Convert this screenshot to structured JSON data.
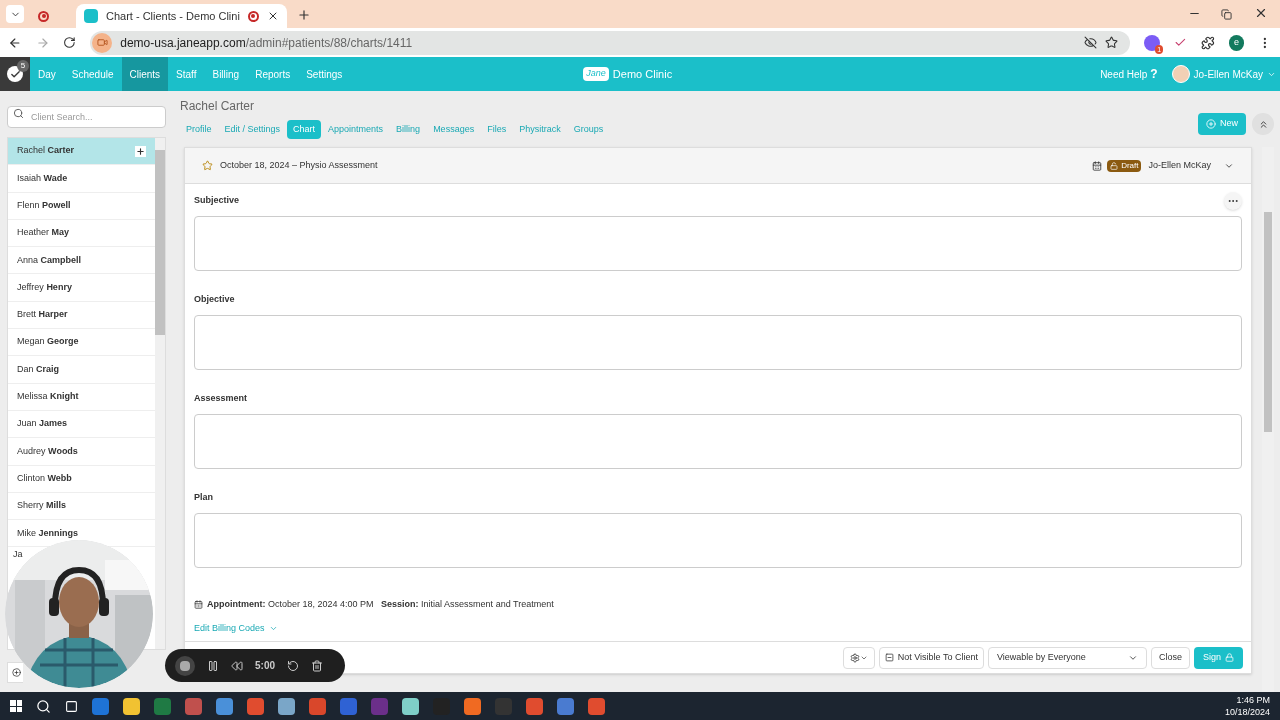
{
  "browser": {
    "tabs": [
      {
        "selected": false
      },
      {
        "title": "Chart - Clients - Demo Clini",
        "selected": true
      }
    ],
    "url_host": "demo-usa.janeapp.com",
    "url_path": "/admin#patients/88/charts/1411",
    "profile_initial": "e",
    "extension_badge": "1"
  },
  "nav": {
    "badge": "5",
    "items": [
      {
        "label": "Day",
        "selected": false
      },
      {
        "label": "Schedule",
        "selected": false
      },
      {
        "label": "Clients",
        "selected": true
      },
      {
        "label": "Staff",
        "selected": false
      },
      {
        "label": "Billing",
        "selected": false
      },
      {
        "label": "Reports",
        "selected": false
      },
      {
        "label": "Settings",
        "selected": false
      }
    ],
    "logo": "Jane",
    "clinic": "Demo Clinic",
    "help": "Need Help",
    "help_mark": "?",
    "user": "Jo-Ellen McKay"
  },
  "sidebar": {
    "search": {
      "placeholder": "Client Search..."
    },
    "clients": [
      {
        "first": "Rachel",
        "last": "Carter",
        "selected": true
      },
      {
        "first": "Isaiah",
        "last": "Wade",
        "selected": false
      },
      {
        "first": "Flenn",
        "last": "Powell",
        "selected": false
      },
      {
        "first": "Heather",
        "last": "May",
        "selected": false
      },
      {
        "first": "Anna",
        "last": "Campbell",
        "selected": false
      },
      {
        "first": "Jeffrey",
        "last": "Henry",
        "selected": false
      },
      {
        "first": "Brett",
        "last": "Harper",
        "selected": false
      },
      {
        "first": "Megan",
        "last": "George",
        "selected": false
      },
      {
        "first": "Dan",
        "last": "Craig",
        "selected": false
      },
      {
        "first": "Melissa",
        "last": "Knight",
        "selected": false
      },
      {
        "first": "Juan",
        "last": "James",
        "selected": false
      },
      {
        "first": "Audrey",
        "last": "Woods",
        "selected": false
      },
      {
        "first": "Clinton",
        "last": "Webb",
        "selected": false
      },
      {
        "first": "Sherry",
        "last": "Mills",
        "selected": false
      },
      {
        "first": "Mike",
        "last": "Jennings",
        "selected": false
      },
      {
        "first": "Ja",
        "selected": false
      }
    ]
  },
  "client": {
    "name": "Rachel Carter",
    "tabs": [
      {
        "label": "Profile",
        "selected": false
      },
      {
        "label": "Edit / Settings",
        "selected": false
      },
      {
        "label": "Chart",
        "selected": true
      },
      {
        "label": "Appointments",
        "selected": false
      },
      {
        "label": "Billing",
        "selected": false
      },
      {
        "label": "Messages",
        "selected": false
      },
      {
        "label": "Files",
        "selected": false
      },
      {
        "label": "Physitrack",
        "selected": false
      },
      {
        "label": "Groups",
        "selected": false
      }
    ],
    "new_button": "New"
  },
  "chart": {
    "title": "October 18, 2024 – Physio Assessment",
    "status": "Draft",
    "author": "Jo-Ellen McKay",
    "sections": [
      {
        "label": "Subjective"
      },
      {
        "label": "Objective"
      },
      {
        "label": "Assessment"
      },
      {
        "label": "Plan"
      }
    ],
    "appointment": "**Appointment:** October 18, 2024 4:00 PM   **Session:** Initial Assessment and Treatment",
    "billing_link": "Edit Billing Codes",
    "footer": {
      "visibility_button": "Not Visible To Client",
      "viewable_select": "Viewable by Everyone",
      "close": "Close",
      "sign": "Sign"
    }
  },
  "recorder": {
    "time": "5:00"
  },
  "taskbar": {
    "time": "1:46 PM",
    "date": "10/18/2024"
  }
}
